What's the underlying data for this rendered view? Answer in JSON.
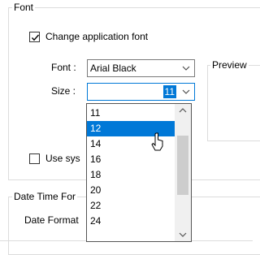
{
  "font_group": {
    "legend": "Font"
  },
  "change_font": {
    "label": "Change application font",
    "checked": true
  },
  "font_field": {
    "label": "Font :",
    "value": "Arial Black"
  },
  "size_field": {
    "label": "Size :",
    "value": "11"
  },
  "preview_group": {
    "legend": "Preview"
  },
  "use_system": {
    "label": "Use sys",
    "checked": false
  },
  "date_group": {
    "legend": "Date Time For"
  },
  "date_format": {
    "label": "Date Format"
  },
  "size_options": [
    "11",
    "12",
    "14",
    "16",
    "18",
    "20",
    "22",
    "24"
  ],
  "selected_option": "12",
  "scroll": {
    "position_fraction": 0.35
  },
  "colors": {
    "accent": "#0078d7",
    "border": "#dcdcdc"
  },
  "icons": {
    "checkmark": "checkmark-icon",
    "combo_arrow": "chevron-down-icon",
    "scroll_up": "chevron-up-icon",
    "scroll_down": "chevron-down-icon",
    "pointer": "mouse-cursor-icon"
  }
}
